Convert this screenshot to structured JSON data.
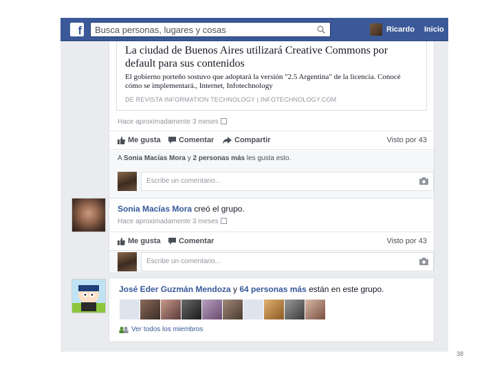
{
  "header": {
    "search_placeholder": "Busca personas, lugares y cosas",
    "user_name": "Ricardo",
    "home_label": "Inicio"
  },
  "post1": {
    "link_title": "La ciudad de Buenos Aires utilizará Creative Commons por default para sus contenidos",
    "link_description": "El gobierno porteño sostuvo que adoptará la versión \"2.5 Argentina\" de la licencia. Conocé cómo se implementará., Internet, Infotechnology",
    "link_source": "DE REVISTA INFORMATION TECHNOLOGY   |   INFOTECHNOLOGY.COM",
    "timestamp": "Hace aproximadamente 3 meses",
    "like_label": "Me gusta",
    "comment_label": "Comentar",
    "share_label": "Compartir",
    "seen_by": "Visto por 43",
    "likes_prefix": "A ",
    "likes_name": "Sonia Macías Mora",
    "likes_middle": " y ",
    "likes_others": "2 personas más",
    "likes_suffix": " les gusta esto.",
    "comment_placeholder": "Escribe un comentario..."
  },
  "post2": {
    "actor": "Sonia Macías Mora",
    "action": " creó el grupo.",
    "timestamp": "Hace aproximadamente 3 meses",
    "like_label": "Me gusta",
    "comment_label": "Comentar",
    "seen_by": "Visto por 43",
    "comment_placeholder": "Escribe un comentario..."
  },
  "members": {
    "name": "José Eder Guzmán Mendoza",
    "middle": " y ",
    "others": "64 personas más",
    "suffix": " están en este grupo.",
    "see_all": "Ver todos los miembros"
  },
  "page_number": "38",
  "colors": {
    "brand_blue": "#3b5998",
    "link_blue": "#365899",
    "background": "#e9ebee"
  }
}
